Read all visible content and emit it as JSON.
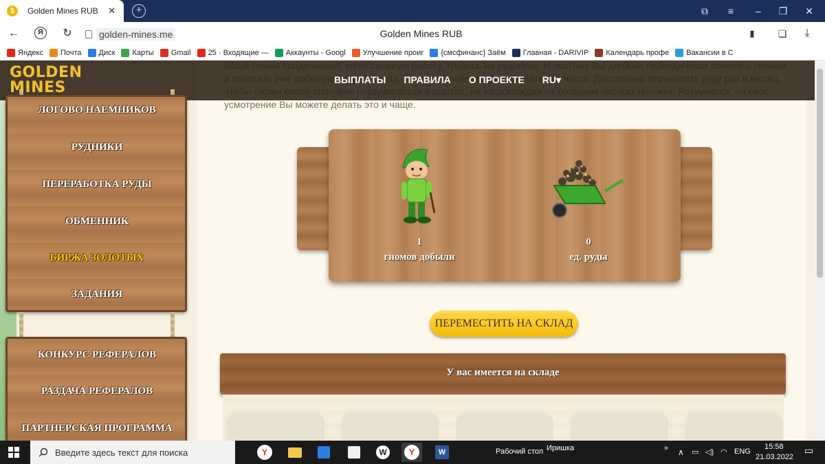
{
  "browser": {
    "tab_title": "Golden Mines RUB",
    "tab_favicon": "$",
    "tab_close": "✕",
    "url": "golden-mines.me",
    "page_title": "Golden Mines RUB",
    "bookmarks": [
      {
        "label": "Яндекс",
        "color": "#e5271a"
      },
      {
        "label": "Почта",
        "color": "#e58a1a"
      },
      {
        "label": "Диск",
        "color": "#2a7de1"
      },
      {
        "label": "Карты",
        "color": "#3fa34d"
      },
      {
        "label": "Gmail",
        "color": "#d93025"
      },
      {
        "label": "25 · Входящие —",
        "color": "#e5271a"
      },
      {
        "label": "Аккаунты - Googl",
        "color": "#0f9d58"
      },
      {
        "label": "Улучшение проиг",
        "color": "#ea5b2a"
      },
      {
        "label": "{смсфинанс} Заём",
        "color": "#2a7de1"
      },
      {
        "label": "Главная - DARIVIP",
        "color": "#1d2e5a"
      },
      {
        "label": "Календарь профе",
        "color": "#8a3b2a"
      },
      {
        "label": "Вакансии в С",
        "color": "#2a9de1"
      }
    ]
  },
  "header": {
    "logo_line1": "GOLDEN",
    "logo_line2": "MINES",
    "menu": [
      "ВЫПЛАТЫ",
      "ПРАВИЛА",
      "О ПРОЕКТЕ",
      "RU▾"
    ]
  },
  "intro_text": "Ваши гномы проделывают колоссальную работу, трудясь на рудниках. И поэтому Вы должны периодически помогать гномам и относить уже добытую руду на склад. Совсем не обязательно делать это часто. Достаточно переносить руду раз в месяц, чтобы гномы могли спокойно передвигаться в шахтах, не загромождая их большим числом тележек. Разумеется, на свое усмотрение Вы можете делать это и чаще.",
  "sidebar": {
    "group1": [
      "ЛОГОВО НАЕМНИКОВ",
      "РУДНИКИ",
      "ПЕРЕРАБОТКА РУДЫ",
      "ОБМЕННИК",
      "БИРЖА ЗОЛОТЫХ",
      "ЗАДАНИЯ"
    ],
    "group2": [
      "КОНКУРС РЕФЕРАЛОВ",
      "РАЗДАЧА РЕФЕРАЛОВ",
      "ПАРТНЕРСКАЯ ПРОГРАММА"
    ],
    "active_item": "БИРЖА ЗОЛОТЫХ"
  },
  "stats": {
    "gnomes_value": "1",
    "gnomes_label": "гномов добыли",
    "ore_value": "0",
    "ore_label": "ед. руды"
  },
  "move_button": "ПЕРЕМЕСТИТЬ НА СКЛАД",
  "storage": {
    "title": "У вас имеется на складе"
  },
  "taskbar": {
    "search_placeholder": "Введите здесь текст для поиска",
    "desktop_label": "Рабочий стол",
    "user_label": "Иришка",
    "lang": "ENG",
    "time": "15:58",
    "date": "21.03.2022"
  },
  "colors": {
    "accent_gold": "#f5c02b",
    "button_yellow": "#f3bb08",
    "wood": "#b07b4c",
    "browser_dark": "#1d2e5a"
  }
}
